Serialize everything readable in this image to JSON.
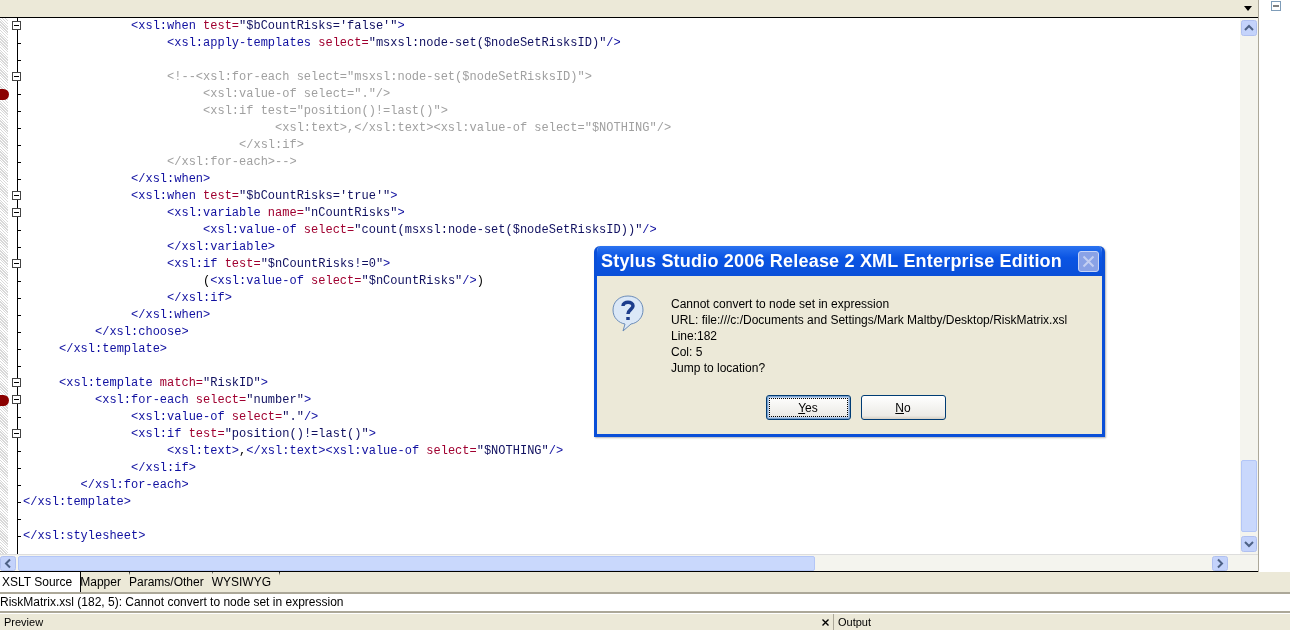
{
  "editor": {
    "lines": [
      {
        "kind": "code",
        "text": "               <xsl:when test=\"$bCountRisks='false'\">",
        "fold": true,
        "breakpoint": false
      },
      {
        "kind": "code",
        "text": "                    <xsl:apply-templates select=\"msxsl:node-set($nodeSetRisksID)\"/>",
        "fold": false,
        "breakpoint": false
      },
      {
        "kind": "blank",
        "fold": false,
        "breakpoint": false
      },
      {
        "kind": "comment",
        "text": "                    <!--<xsl:for-each select=\"msxsl:node-set($nodeSetRisksID)\">",
        "fold": true,
        "breakpoint": false
      },
      {
        "kind": "comment",
        "text": "                         <xsl:value-of select=\".\"/>",
        "fold": false,
        "breakpoint": true
      },
      {
        "kind": "comment",
        "text": "                         <xsl:if test=\"position()!=last()\">",
        "fold": false,
        "breakpoint": false
      },
      {
        "kind": "comment",
        "text": "                                   <xsl:text>,</xsl:text><xsl:value-of select=\"$NOTHING\"/>",
        "fold": false,
        "breakpoint": false
      },
      {
        "kind": "comment",
        "text": "                              </xsl:if>",
        "fold": false,
        "breakpoint": false
      },
      {
        "kind": "comment",
        "text": "                    </xsl:for-each>-->",
        "fold": false,
        "breakpoint": false
      },
      {
        "kind": "code",
        "text": "               </xsl:when>",
        "fold": false,
        "breakpoint": false
      },
      {
        "kind": "code",
        "text": "               <xsl:when test=\"$bCountRisks='true'\">",
        "fold": true,
        "breakpoint": false
      },
      {
        "kind": "code",
        "text": "                    <xsl:variable name=\"nCountRisks\">",
        "fold": true,
        "breakpoint": false
      },
      {
        "kind": "code",
        "text": "                         <xsl:value-of select=\"count(msxsl:node-set($nodeSetRisksID))\"/>",
        "fold": false,
        "breakpoint": false
      },
      {
        "kind": "code",
        "text": "                    </xsl:variable>",
        "fold": false,
        "breakpoint": false
      },
      {
        "kind": "code",
        "text": "                    <xsl:if test=\"$nCountRisks!=0\">",
        "fold": true,
        "breakpoint": false
      },
      {
        "kind": "code",
        "text": "                         (<xsl:value-of select=\"$nCountRisks\"/>)",
        "fold": false,
        "breakpoint": false
      },
      {
        "kind": "code",
        "text": "                    </xsl:if>",
        "fold": false,
        "breakpoint": false
      },
      {
        "kind": "code",
        "text": "               </xsl:when>",
        "fold": false,
        "breakpoint": false
      },
      {
        "kind": "code",
        "text": "          </xsl:choose>",
        "fold": false,
        "breakpoint": false
      },
      {
        "kind": "code",
        "text": "     </xsl:template>",
        "fold": false,
        "breakpoint": false
      },
      {
        "kind": "blank",
        "fold": false,
        "breakpoint": false
      },
      {
        "kind": "code",
        "text": "     <xsl:template match=\"RiskID\">",
        "fold": true,
        "breakpoint": false
      },
      {
        "kind": "code",
        "text": "          <xsl:for-each select=\"number\">",
        "fold": true,
        "breakpoint": true
      },
      {
        "kind": "code",
        "text": "               <xsl:value-of select=\".\"/>",
        "fold": false,
        "breakpoint": false
      },
      {
        "kind": "code",
        "text": "               <xsl:if test=\"position()!=last()\">",
        "fold": true,
        "breakpoint": false
      },
      {
        "kind": "code",
        "text": "                    <xsl:text>,</xsl:text><xsl:value-of select=\"$NOTHING\"/>",
        "fold": false,
        "breakpoint": false
      },
      {
        "kind": "code",
        "text": "               </xsl:if>",
        "fold": false,
        "breakpoint": false
      },
      {
        "kind": "code",
        "text": "        </xsl:for-each>",
        "fold": false,
        "breakpoint": false
      },
      {
        "kind": "code",
        "text": "</xsl:template>",
        "fold": false,
        "breakpoint": false
      },
      {
        "kind": "blank",
        "fold": false,
        "breakpoint": false
      },
      {
        "kind": "code",
        "text": "</xsl:stylesheet>",
        "fold": false,
        "breakpoint": false
      }
    ]
  },
  "editor_tabs": [
    {
      "label": "XSLT Source",
      "selected": true
    },
    {
      "label": "Mapper",
      "selected": false
    },
    {
      "label": "Params/Other",
      "selected": false
    },
    {
      "label": "WYSIWYG",
      "selected": false
    }
  ],
  "status_message": "RiskMatrix.xsl (182, 5): Cannot convert to node set in expression",
  "bottom_panels": [
    {
      "title": "Preview"
    },
    {
      "title": "Output"
    }
  ],
  "dialog": {
    "title": "Stylus Studio 2006 Release 2 XML Enterprise Edition",
    "message_lines": [
      "Cannot convert to node set in expression",
      "URL: file:///c:/Documents and Settings/Mark Maltby/Desktop/RiskMatrix.xsl",
      "Line:182",
      "Col: 5",
      "Jump to location?"
    ],
    "buttons": [
      {
        "label": "Yes",
        "focused": true
      },
      {
        "label": "No",
        "focused": false
      }
    ]
  }
}
